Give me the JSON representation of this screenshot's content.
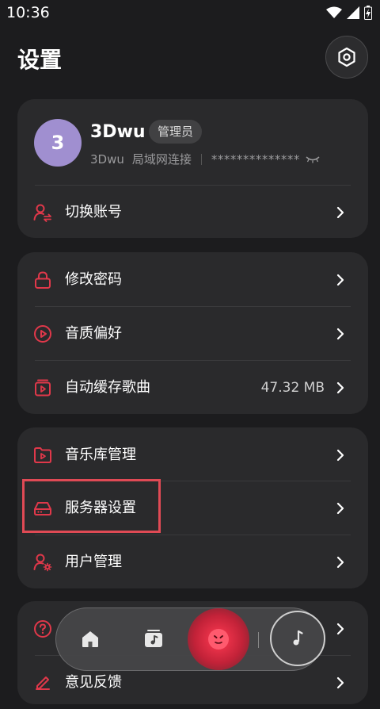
{
  "status_bar": {
    "time": "10:36"
  },
  "header": {
    "title": "设置"
  },
  "account": {
    "avatar_letter": "3",
    "username": "3Dwu",
    "role": "管理员",
    "server_name": "3Dwu",
    "connection": "局域网连接",
    "masked_address": "**************",
    "switch_label": "切换账号"
  },
  "group1": {
    "change_password": "修改密码",
    "audio_quality": "音质偏好",
    "auto_cache": "自动缓存歌曲",
    "auto_cache_size": "47.32 MB"
  },
  "group2": {
    "library_manage": "音乐库管理",
    "server_settings": "服务器设置",
    "user_manage": "用户管理"
  },
  "group3": {
    "feedback": "意见反馈"
  },
  "colors": {
    "accent": "#e0384a",
    "background": "#1c1c1e",
    "card": "#2a2a2c",
    "avatar": "#a08fd0"
  }
}
